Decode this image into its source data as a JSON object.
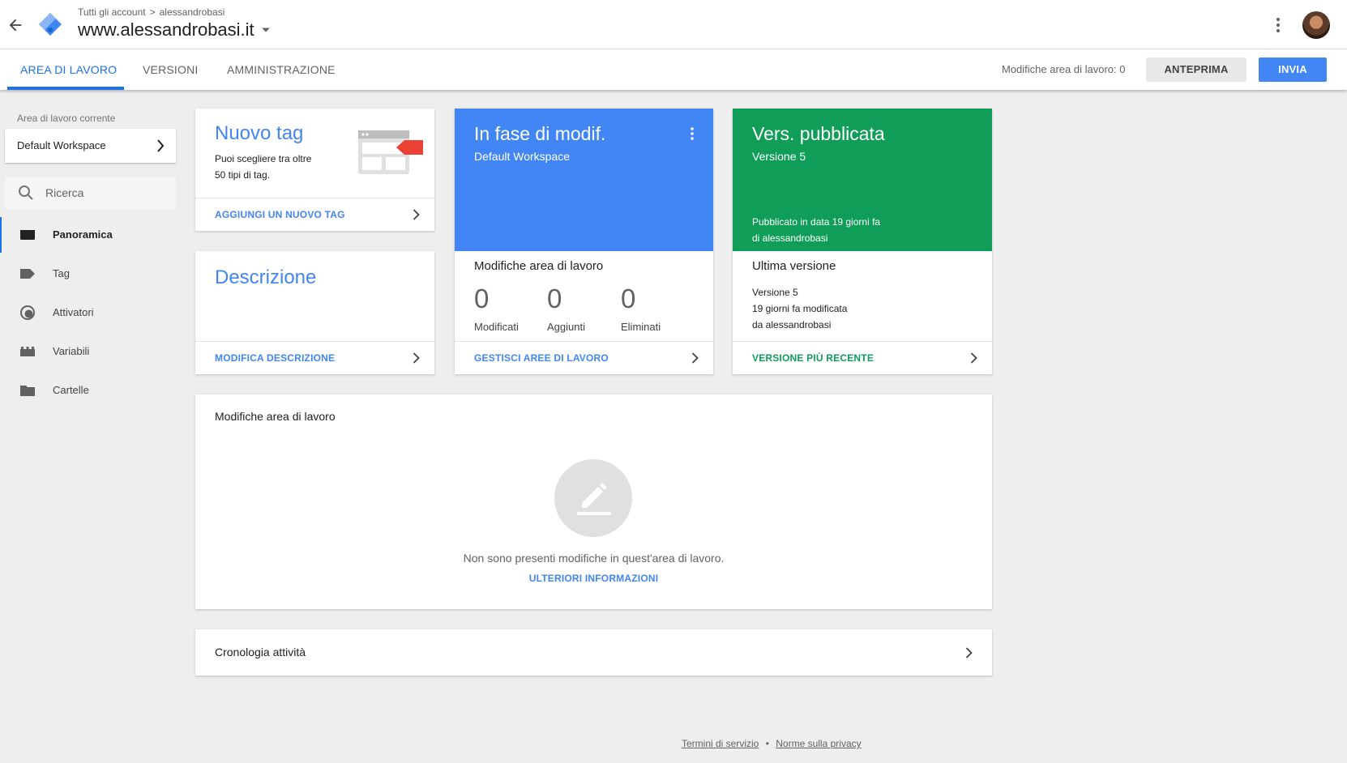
{
  "header": {
    "breadcrumb_root": "Tutti gli account",
    "breadcrumb_separator": ">",
    "breadcrumb_account": "alessandrobasi",
    "container_name": "www.alessandrobasi.it"
  },
  "nav": {
    "tabs": [
      {
        "label": "AREA DI LAVORO"
      },
      {
        "label": "VERSIONI"
      },
      {
        "label": "AMMINISTRAZIONE"
      }
    ],
    "changes_count_text": "Modifiche area di lavoro: 0",
    "preview_label": "ANTEPRIMA",
    "submit_label": "INVIA"
  },
  "sidebar": {
    "workspace_label": "Area di lavoro corrente",
    "workspace_name": "Default Workspace",
    "search_placeholder": "Ricerca",
    "items": [
      {
        "label": "Panoramica",
        "icon": "overview-icon"
      },
      {
        "label": "Tag",
        "icon": "tag-icon"
      },
      {
        "label": "Attivatori",
        "icon": "trigger-icon"
      },
      {
        "label": "Variabili",
        "icon": "variables-icon"
      },
      {
        "label": "Cartelle",
        "icon": "folder-icon"
      }
    ]
  },
  "cards": {
    "new_tag": {
      "title": "Nuovo tag",
      "desc_line1": "Puoi scegliere tra oltre",
      "desc_line2": "50 tipi di tag.",
      "action": "AGGIUNGI UN NUOVO TAG"
    },
    "description": {
      "title": "Descrizione",
      "action": "MODIFICA DESCRIZIONE"
    },
    "editing": {
      "title": "In fase di modif.",
      "subtitle": "Default Workspace",
      "section_title": "Modifiche area di lavoro",
      "modified_count": "0",
      "modified_label": "Modificati",
      "added_count": "0",
      "added_label": "Aggiunti",
      "deleted_count": "0",
      "deleted_label": "Eliminati",
      "action": "GESTISCI AREE DI LAVORO",
      "color": "#4285f4"
    },
    "published": {
      "title": "Vers. pubblicata",
      "subtitle": "Versione 5",
      "published_line1": "Pubblicato in data 19 giorni fa",
      "published_line2": "di alessandrobasi",
      "section_title": "Ultima versione",
      "version_line1": "Versione 5",
      "version_line2": "19 giorni fa modificata",
      "version_line3": "da alessandrobasi",
      "action": "VERSIONE PIÙ RECENTE",
      "color": "#0f9d58"
    }
  },
  "changes_panel": {
    "title": "Modifiche area di lavoro",
    "empty_text": "Non sono presenti modifiche in quest'area di lavoro.",
    "learn_more": "ULTERIORI INFORMAZIONI"
  },
  "activity_panel": {
    "title": "Cronologia attività"
  },
  "footer": {
    "terms": "Termini di servizio",
    "separator": "•",
    "privacy": "Norme sulla privacy"
  },
  "colors": {
    "accent": "#1a73e8",
    "blue": "#4285f4",
    "green": "#0f9d58",
    "tag_red": "#ea4335"
  }
}
